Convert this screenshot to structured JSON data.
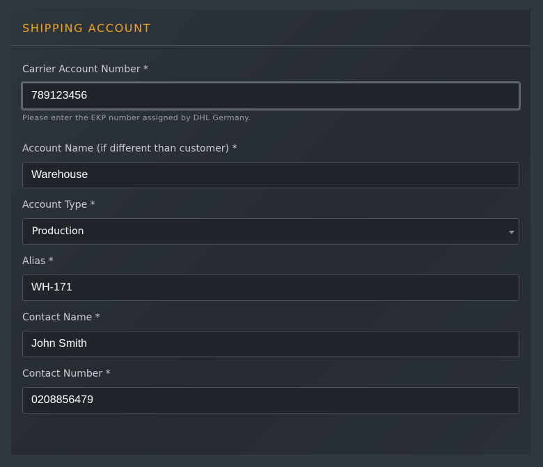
{
  "panel": {
    "title": "SHIPPING ACCOUNT"
  },
  "fields": {
    "carrier_account_number": {
      "label": "Carrier Account Number *",
      "value": "789123456",
      "help": "Please enter the EKP number assigned by DHL Germany."
    },
    "account_name": {
      "label": "Account Name (if different than customer) *",
      "value": "Warehouse"
    },
    "account_type": {
      "label": "Account Type *",
      "value": "Production"
    },
    "alias": {
      "label": "Alias *",
      "value": "WH-171"
    },
    "contact_name": {
      "label": "Contact Name *",
      "value": "John Smith"
    },
    "contact_number": {
      "label": "Contact Number *",
      "value": "0208856479"
    }
  },
  "colors": {
    "accent": "#f0a31c",
    "background": "#2f3740",
    "input_background": "#21252b",
    "border": "#4b525a"
  },
  "icons": {
    "account_type_dropdown": "chevron-down-icon"
  }
}
